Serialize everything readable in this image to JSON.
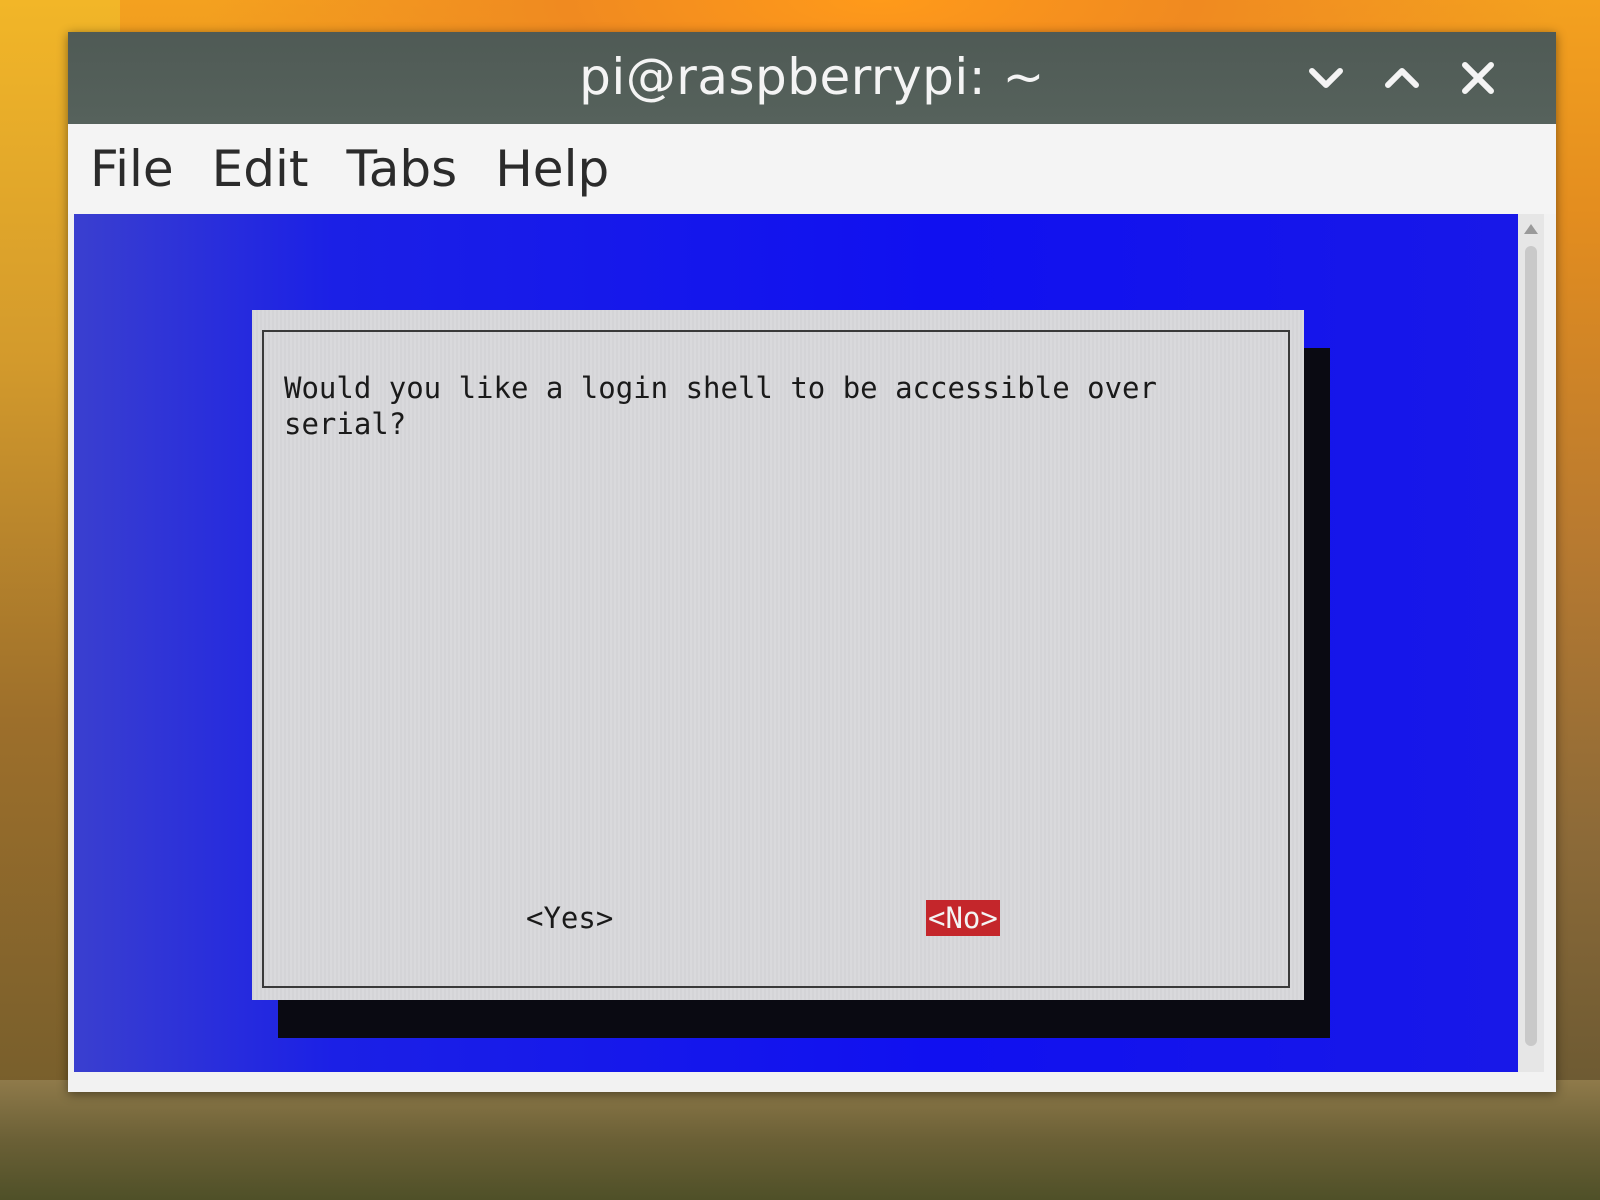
{
  "window": {
    "title": "pi@raspberrypi: ~",
    "controls": [
      "minimize",
      "maximize",
      "close"
    ]
  },
  "menubar": {
    "items": [
      "File",
      "Edit",
      "Tabs",
      "Help"
    ]
  },
  "dialog": {
    "message": "Would you like a login shell to be accessible over\nserial?",
    "buttons": {
      "yes": "<Yes>",
      "no": "<No>"
    },
    "selected_button": "no"
  },
  "colors": {
    "terminal_background": "#1010f0",
    "dialog_background": "#d9d9dc",
    "selected_button": "#c4262b",
    "titlebar": "#56625c"
  }
}
